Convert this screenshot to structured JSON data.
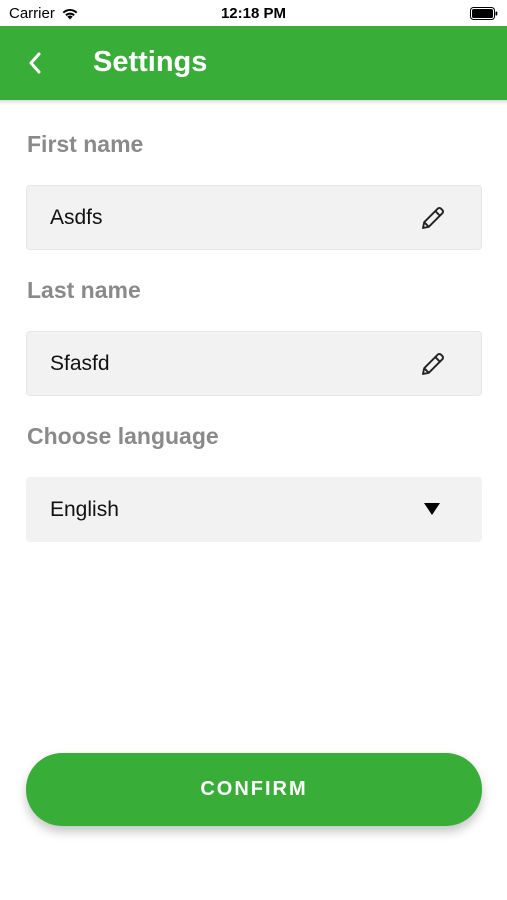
{
  "status_bar": {
    "carrier": "Carrier",
    "time": "12:18 PM",
    "icons": [
      "wifi-icon",
      "battery-icon"
    ]
  },
  "header": {
    "title": "Settings",
    "back_icon": "chevron-left-icon",
    "background_color": "#38ae38"
  },
  "form": {
    "first_name": {
      "label": "First name",
      "value": "Asdfs",
      "icon": "pencil-icon"
    },
    "last_name": {
      "label": "Last name",
      "value": "Sfasfd",
      "icon": "pencil-icon"
    },
    "language": {
      "label": "Choose language",
      "value": "English",
      "icon": "dropdown-triangle-icon"
    }
  },
  "confirm_button": {
    "label": "CONFIRM",
    "color": "#38ae38"
  }
}
